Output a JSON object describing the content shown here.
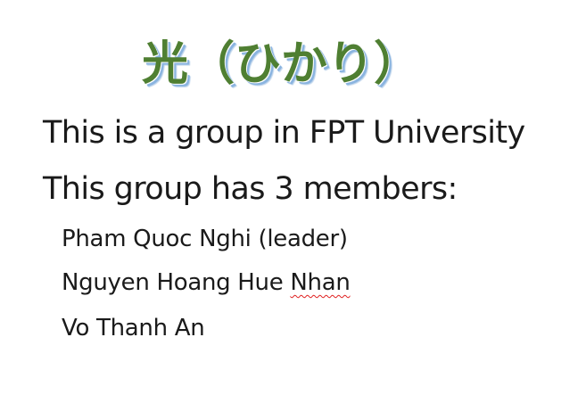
{
  "document": {
    "title": "光（ひかり）",
    "intro_line": "This is a group in FPT University",
    "members_line": "This group has 3 members:",
    "members": [
      {
        "first_part": "Pham Quoc Nghi (leader)",
        "flagged_word": ""
      },
      {
        "first_part": "Nguyen Hoang Hue ",
        "flagged_word": "Nhan"
      },
      {
        "first_part": "Vo Thanh An",
        "flagged_word": ""
      }
    ],
    "colors": {
      "title": "#4f7f32",
      "title_shadow": "#8ab4e0",
      "body_text": "#1a1a1a",
      "spellcheck_underline": "#e02020"
    }
  }
}
